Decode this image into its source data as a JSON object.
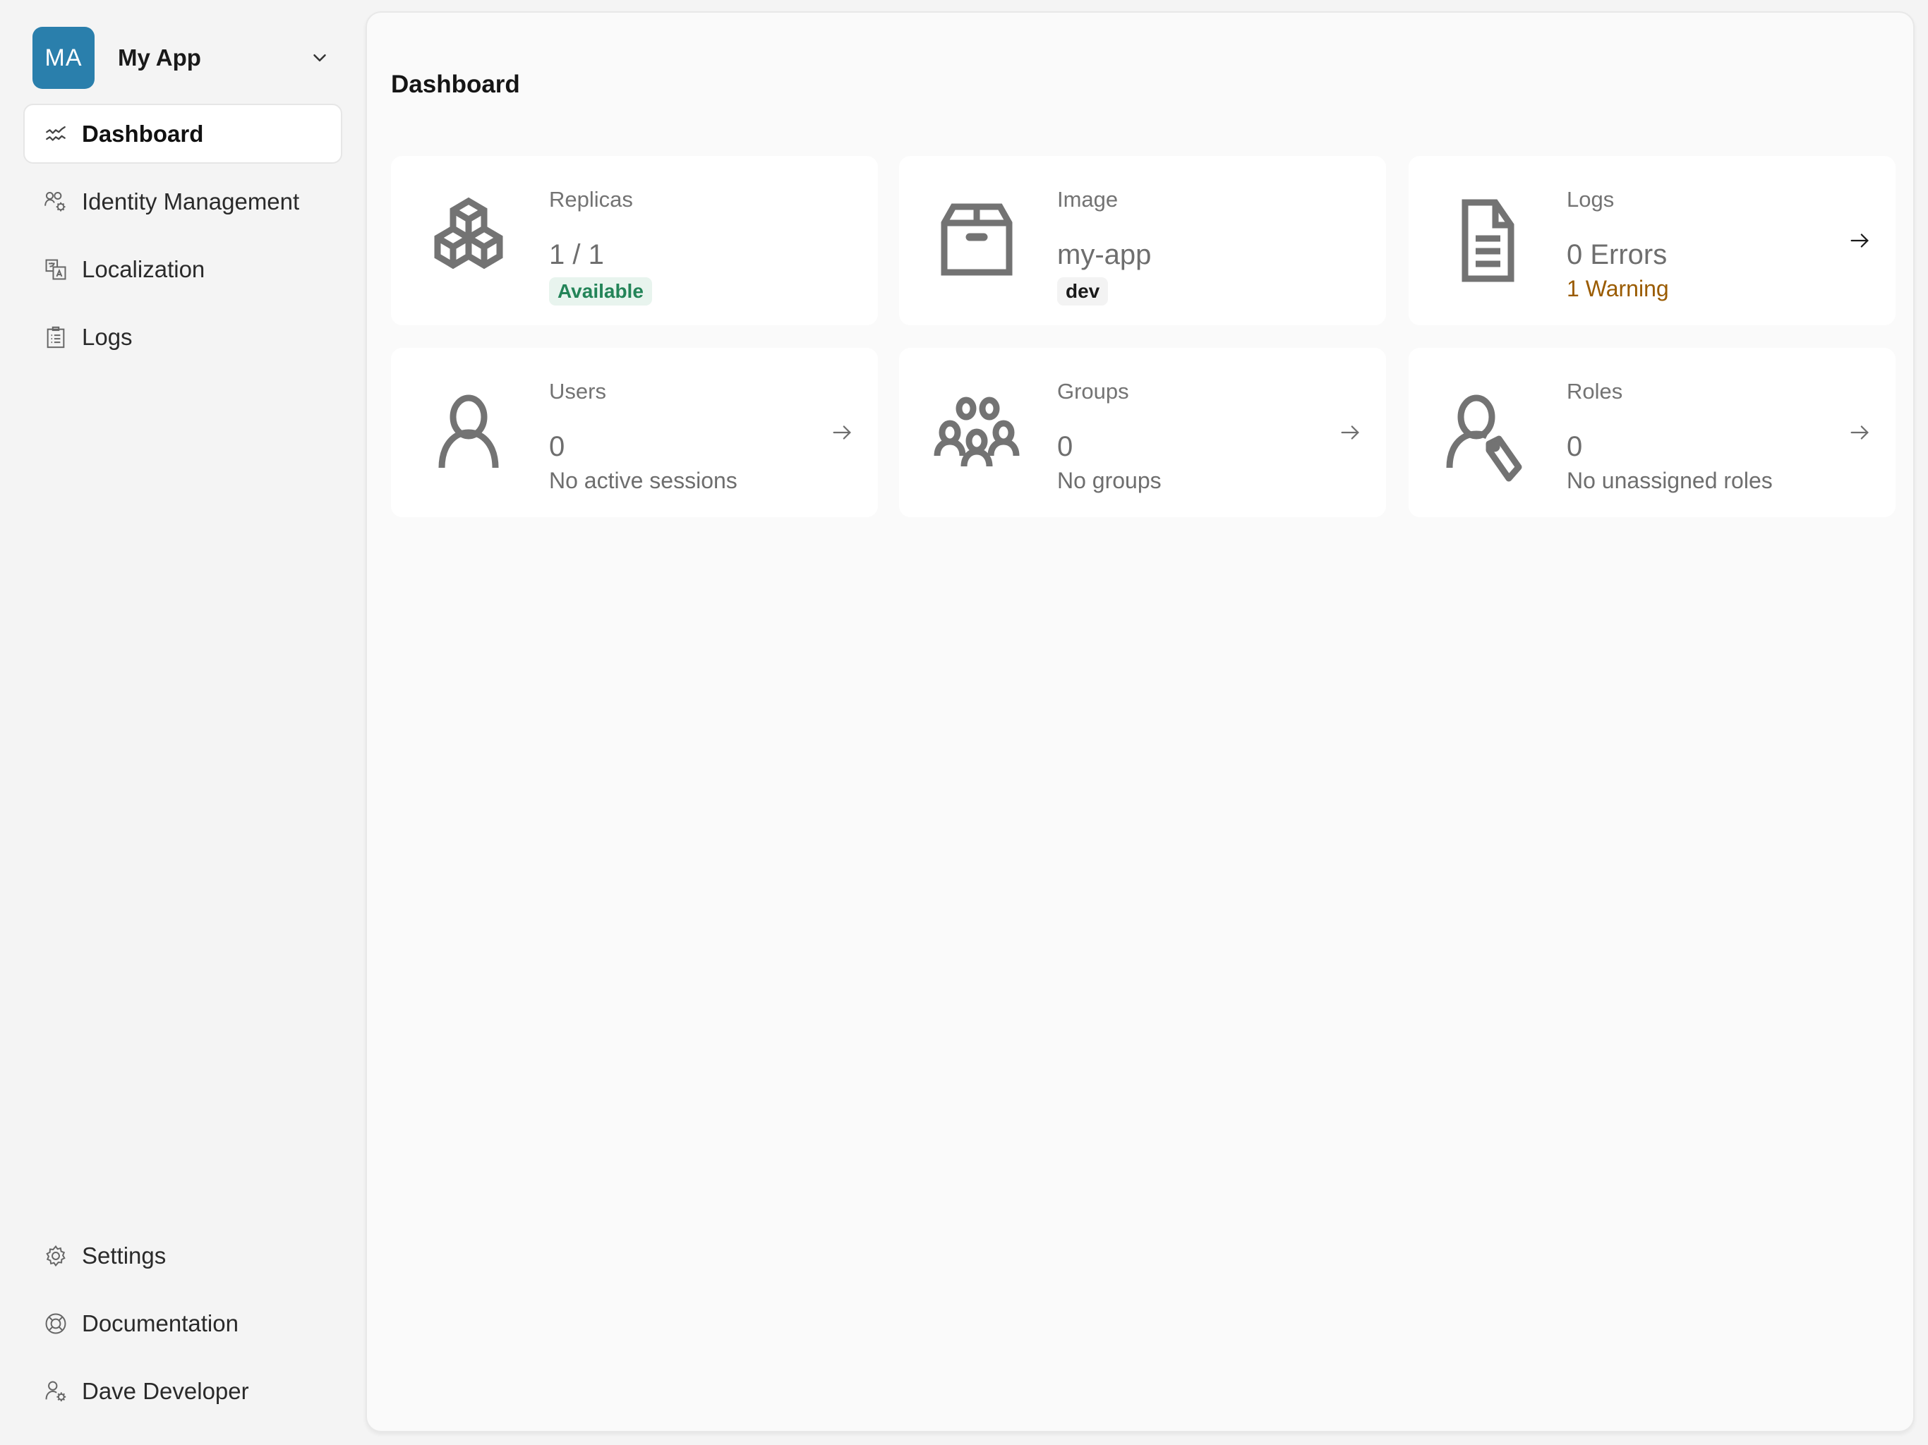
{
  "app": {
    "initials": "MA",
    "name": "My App",
    "avatar_color": "#2a7fac"
  },
  "sidebar": {
    "items": [
      {
        "label": "Dashboard",
        "icon": "activity-icon",
        "active": true
      },
      {
        "label": "Identity Management",
        "icon": "users-gear-icon",
        "active": false
      },
      {
        "label": "Localization",
        "icon": "translate-icon",
        "active": false
      },
      {
        "label": "Logs",
        "icon": "clipboard-list-icon",
        "active": false
      }
    ],
    "footer_items": [
      {
        "label": "Settings",
        "icon": "gear-icon"
      },
      {
        "label": "Documentation",
        "icon": "lifebuoy-icon"
      },
      {
        "label": "Dave Developer",
        "icon": "user-gear-icon"
      }
    ]
  },
  "main": {
    "title": "Dashboard",
    "cards": [
      {
        "label": "Replicas",
        "value": "1 / 1",
        "badge": "Available",
        "badge_color": "#238458",
        "icon": "cubes-icon"
      },
      {
        "label": "Image",
        "value": "my-app",
        "badge": "dev",
        "icon": "box-icon"
      },
      {
        "label": "Logs",
        "value": "0 Errors",
        "sub": "1 Warning",
        "sub_color": "#9a5b00",
        "icon": "document-icon",
        "arrow": true
      },
      {
        "label": "Users",
        "value": "0",
        "sub": "No active sessions",
        "icon": "user-icon",
        "arrow": true
      },
      {
        "label": "Groups",
        "value": "0",
        "sub": "No groups",
        "icon": "group-icon",
        "arrow": true
      },
      {
        "label": "Roles",
        "value": "0",
        "sub": "No unassigned roles",
        "icon": "user-tag-icon",
        "arrow": true
      }
    ]
  }
}
